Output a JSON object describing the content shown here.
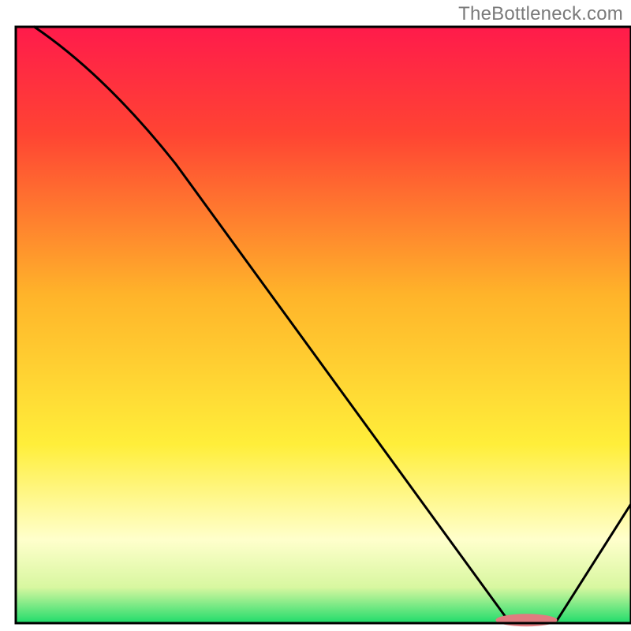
{
  "attribution": "TheBottleneck.com",
  "chart_data": {
    "type": "line",
    "title": "",
    "xlabel": "",
    "ylabel": "",
    "x_range": [
      0,
      100
    ],
    "y_range": [
      0,
      100
    ],
    "line": {
      "name": "curve",
      "x": [
        3,
        26,
        80,
        88,
        100
      ],
      "y": [
        100,
        77,
        0.5,
        0.5,
        20
      ]
    },
    "marker": {
      "name": "optimal-segment",
      "x_start": 78,
      "x_end": 88,
      "y": 0.5,
      "color": "#e07c80"
    },
    "gradient_stops": [
      {
        "pct": 0,
        "color": "#ff1b4b"
      },
      {
        "pct": 18,
        "color": "#ff4433"
      },
      {
        "pct": 45,
        "color": "#ffb42a"
      },
      {
        "pct": 70,
        "color": "#ffee3a"
      },
      {
        "pct": 86,
        "color": "#ffffcc"
      },
      {
        "pct": 94,
        "color": "#d8f7a0"
      },
      {
        "pct": 100,
        "color": "#1fdc6b"
      }
    ],
    "frame_color": "#000000",
    "line_color": "#000000",
    "line_width": 3
  }
}
